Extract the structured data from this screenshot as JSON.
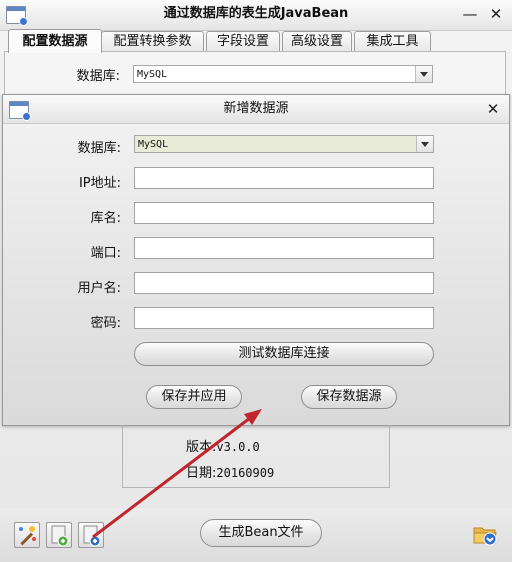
{
  "window": {
    "title": "通过数据库的表生成JavaBean",
    "minimize": "—",
    "close": "✕"
  },
  "tabs": [
    {
      "label": "配置数据源",
      "active": true
    },
    {
      "label": "配置转换参数",
      "active": false
    },
    {
      "label": "字段设置",
      "active": false
    },
    {
      "label": "高级设置",
      "active": false
    },
    {
      "label": "集成工具",
      "active": false
    }
  ],
  "main": {
    "db_label": "数据库:",
    "db_value": "MySQL"
  },
  "dialog": {
    "title": "新增数据源",
    "close": "✕",
    "db_label": "数据库:",
    "db_value": "MySQL",
    "fields": [
      {
        "label": "IP地址:",
        "value": ""
      },
      {
        "label": "库名:",
        "value": ""
      },
      {
        "label": "端口:",
        "value": ""
      },
      {
        "label": "用户名:",
        "value": ""
      },
      {
        "label": "密码:",
        "value": ""
      }
    ],
    "test_button": "测试数据库连接",
    "save_apply_button": "保存并应用",
    "save_button": "保存数据源"
  },
  "info": {
    "version_label": "版本:",
    "version_value": "v3.0.0",
    "date_label": "日期:",
    "date_value": "20160909"
  },
  "bottom": {
    "generate_button": "生成Bean文件"
  },
  "icons": [
    "app-icon",
    "wand-icon",
    "add-datasource-icon",
    "new-datasource-icon",
    "open-folder-icon"
  ],
  "colors": {
    "arrow": "#c0262b",
    "combo_dialog_bg": "#e9ebd9",
    "app_icon_blue": "#3a74d0"
  }
}
